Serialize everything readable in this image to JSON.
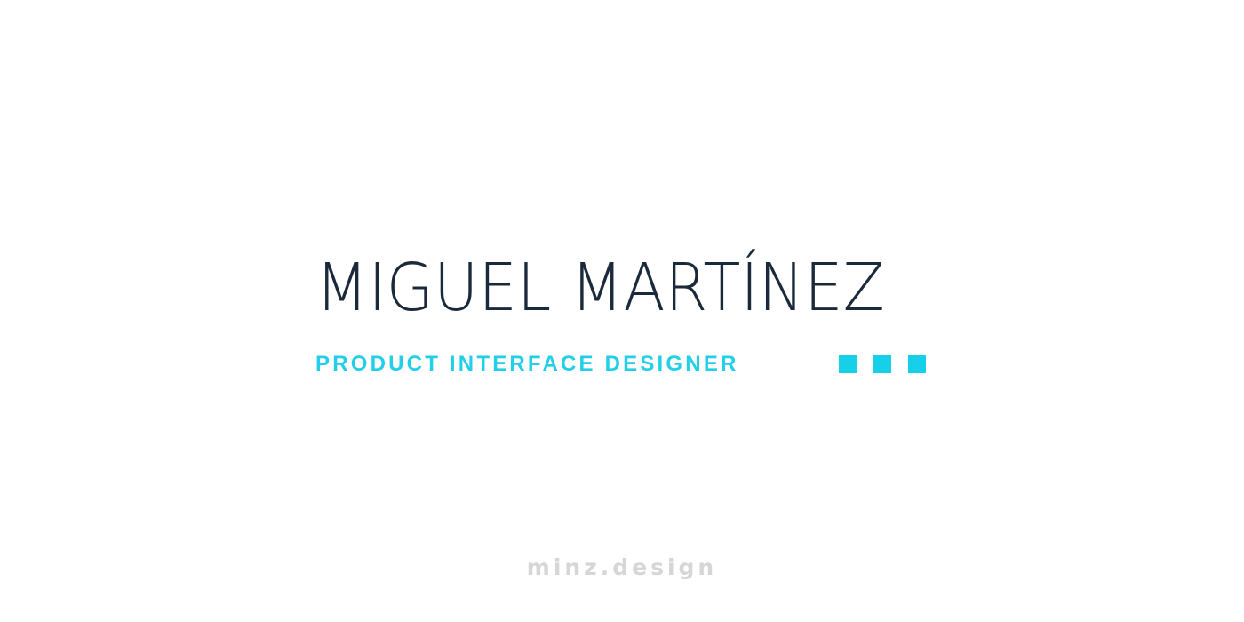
{
  "hero": {
    "name": "MIGUEL MARTÍNEZ",
    "role": "PRODUCT INTERFACE DESIGNER"
  },
  "decoration": {
    "dots": [
      "square",
      "square",
      "square"
    ],
    "accent_color": "#16cfe8",
    "name_color": "#1b2a3a"
  },
  "footer": {
    "site": "minz.design",
    "color": "#d6d6d6"
  }
}
